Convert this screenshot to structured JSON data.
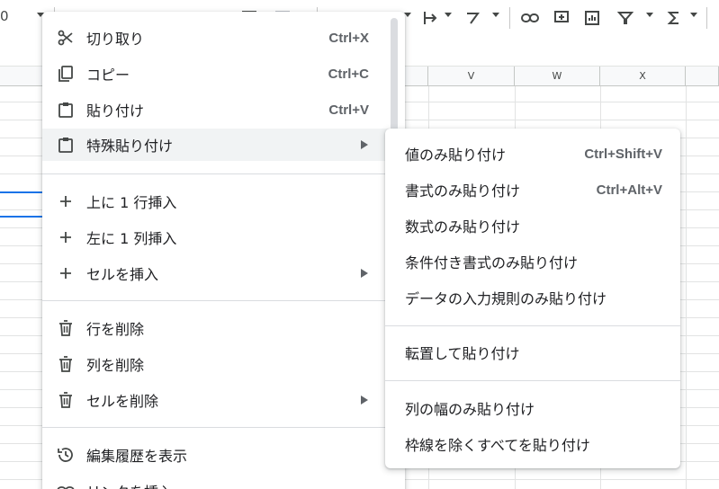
{
  "toolbar": {
    "font_size_value": "0",
    "icons": [
      "bold-icon",
      "strikethrough-icon",
      "text-color-icon",
      "fill-color-icon",
      "borders-icon",
      "merge-icon",
      "align-icon",
      "valign-icon",
      "wrap-icon",
      "rotate-icon",
      "link-icon",
      "comment-icon",
      "chart-icon",
      "filter-icon",
      "functions-icon"
    ]
  },
  "columns": {
    "v": "V",
    "w": "W",
    "x": "X"
  },
  "context_menu": {
    "items": [
      {
        "label": "切り取り",
        "shortcut": "Ctrl+X",
        "icon": "scissors-icon"
      },
      {
        "label": "コピー",
        "shortcut": "Ctrl+C",
        "icon": "copy-icon"
      },
      {
        "label": "貼り付け",
        "shortcut": "Ctrl+V",
        "icon": "clipboard-icon"
      },
      {
        "label": "特殊貼り付け",
        "shortcut": "",
        "icon": "clipboard-icon"
      },
      {
        "label": "上に 1 行挿入",
        "shortcut": "",
        "icon": "plus-icon"
      },
      {
        "label": "左に 1 列挿入",
        "shortcut": "",
        "icon": "plus-icon"
      },
      {
        "label": "セルを挿入",
        "shortcut": "",
        "icon": "plus-icon"
      },
      {
        "label": "行を削除",
        "shortcut": "",
        "icon": "trash-icon"
      },
      {
        "label": "列を削除",
        "shortcut": "",
        "icon": "trash-icon"
      },
      {
        "label": "セルを削除",
        "shortcut": "",
        "icon": "trash-icon"
      },
      {
        "label": "編集履歴を表示",
        "shortcut": "",
        "icon": "history-icon"
      },
      {
        "label": "リンクを挿入",
        "shortcut": "",
        "icon": "link-icon"
      }
    ]
  },
  "paste_special_submenu": {
    "items": [
      {
        "label": "値のみ貼り付け",
        "shortcut": "Ctrl+Shift+V"
      },
      {
        "label": "書式のみ貼り付け",
        "shortcut": "Ctrl+Alt+V"
      },
      {
        "label": "数式のみ貼り付け",
        "shortcut": ""
      },
      {
        "label": "条件付き書式のみ貼り付け",
        "shortcut": ""
      },
      {
        "label": "データの入力規則のみ貼り付け",
        "shortcut": ""
      },
      {
        "label": "転置して貼り付け",
        "shortcut": ""
      },
      {
        "label": "列の幅のみ貼り付け",
        "shortcut": ""
      },
      {
        "label": "枠線を除くすべてを貼り付け",
        "shortcut": ""
      }
    ]
  },
  "colors": {
    "selection": "#1a73e8",
    "menu_text": "#202124",
    "shortcut_text": "#5f6368"
  }
}
